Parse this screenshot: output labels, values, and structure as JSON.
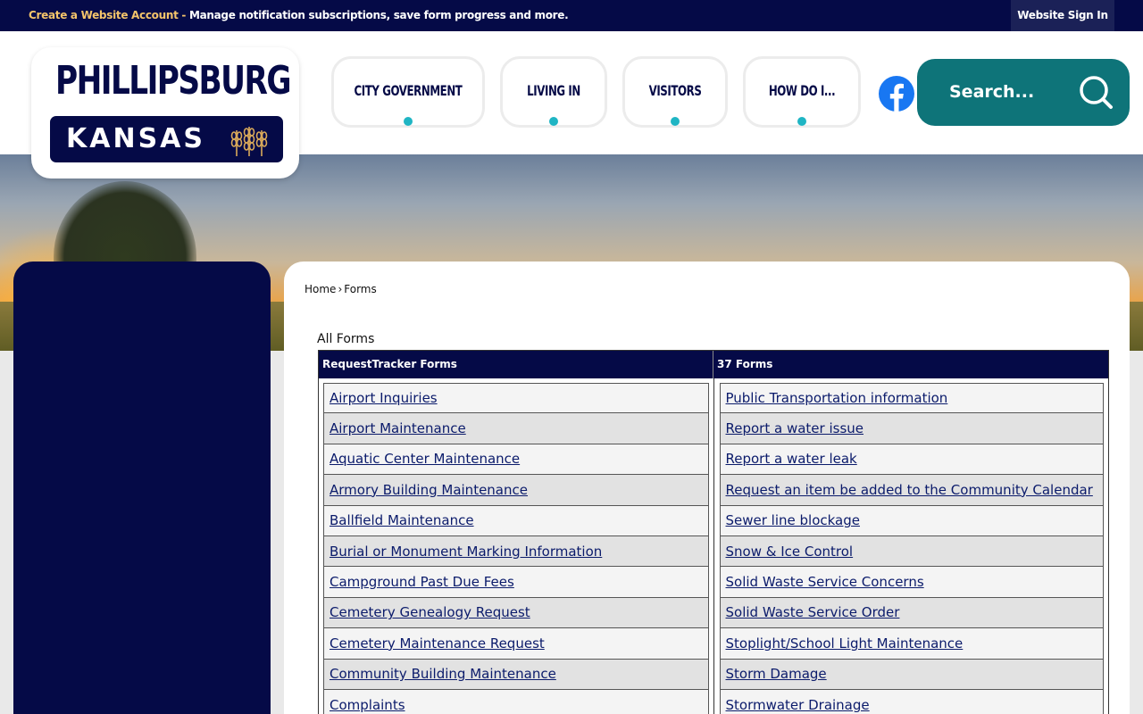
{
  "topbar": {
    "account_link": "Create a Website Account",
    "account_sep": " - ",
    "account_desc": "Manage notification subscriptions, save form progress and more.",
    "signin": "Website Sign In"
  },
  "logo": {
    "city": "PHILLIPSBURG",
    "state": "KANSAS"
  },
  "nav": [
    {
      "label": "CITY GOVERNMENT"
    },
    {
      "label": "LIVING IN"
    },
    {
      "label": "VISITORS"
    },
    {
      "label": "HOW DO I..."
    }
  ],
  "search": {
    "placeholder": "Search..."
  },
  "breadcrumb": {
    "home": "Home",
    "sep": "›",
    "current": "Forms"
  },
  "forms": {
    "heading": "All Forms",
    "category": "RequestTracker Forms",
    "count": "37 Forms",
    "left": [
      "Airport Inquiries",
      "Airport Maintenance",
      "Aquatic Center Maintenance",
      "Armory Building Maintenance",
      "Ballfield Maintenance",
      "Burial or Monument Marking Information",
      "Campground Past Due Fees",
      "Cemetery Genealogy Request",
      "Cemetery Maintenance Request",
      "Community Building Maintenance",
      "Complaints"
    ],
    "right": [
      "Public Transportation information",
      "Report a water issue",
      "Report a water leak",
      "Request an item be added to the Community Calendar",
      "Sewer line blockage",
      "Snow & Ice Control",
      "Solid Waste Service Concerns",
      "Solid Waste Service Order",
      "Stoplight/School Light Maintenance",
      "Storm Damage",
      "Stormwater Drainage"
    ]
  },
  "colors": {
    "navy": "#050a47",
    "teal": "#0e7479",
    "accent_dot": "#1fb5c4",
    "account_link": "#f5c46b",
    "facebook": "#1877f2"
  }
}
